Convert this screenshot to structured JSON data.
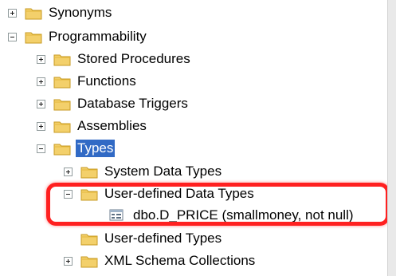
{
  "tree": {
    "synonyms": "Synonyms",
    "programmability": "Programmability",
    "stored_procedures": "Stored Procedures",
    "functions": "Functions",
    "database_triggers": "Database Triggers",
    "assemblies": "Assemblies",
    "types": "Types",
    "system_data_types": "System Data Types",
    "user_defined_data_types": "User-defined Data Types",
    "dbo_d_price": "dbo.D_PRICE (smallmoney, not null)",
    "user_defined_types": "User-defined Types",
    "xml_schema_collections": "XML Schema Collections"
  },
  "colors": {
    "selection": "#316ac5",
    "highlight_border": "#ff2020",
    "folder": "#f3d06b"
  },
  "icons": {
    "folder": "folder-icon",
    "user_defined_data_type": "user-defined-data-type-icon",
    "expand": "expand-plus-icon",
    "collapse": "collapse-minus-icon"
  }
}
